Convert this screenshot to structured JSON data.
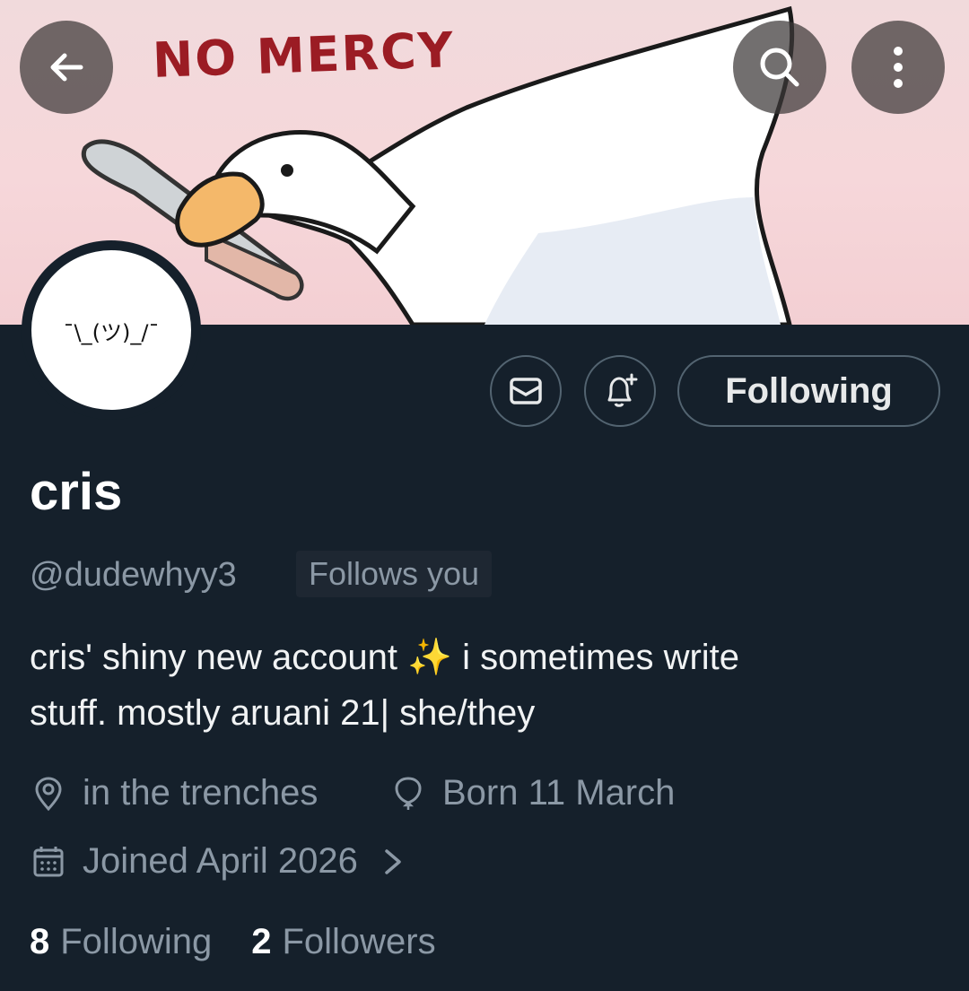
{
  "banner": {
    "text": "NO MERCY"
  },
  "header": {
    "back": "back-icon",
    "search": "search-icon",
    "more": "more-icon"
  },
  "avatar": {
    "text": "¯\\_(ツ)_/¯"
  },
  "actions": {
    "following_label": "Following"
  },
  "profile": {
    "name": "cris",
    "handle": "@dudewhyy3",
    "follows_you": "Follows you",
    "bio_line1": "cris' shiny new account ✨  i sometimes write",
    "bio_line2": "stuff. mostly aruani 21| she/they",
    "location": "in the trenches",
    "birthday": "Born 11 March",
    "joined": "Joined April 2026"
  },
  "stats": {
    "following_count": "8",
    "following_label": "Following",
    "followers_count": "2",
    "followers_label": "Followers"
  },
  "colors": {
    "background": "#15202b",
    "muted": "#8b98a5",
    "banner_pink": "#f6d7da"
  }
}
